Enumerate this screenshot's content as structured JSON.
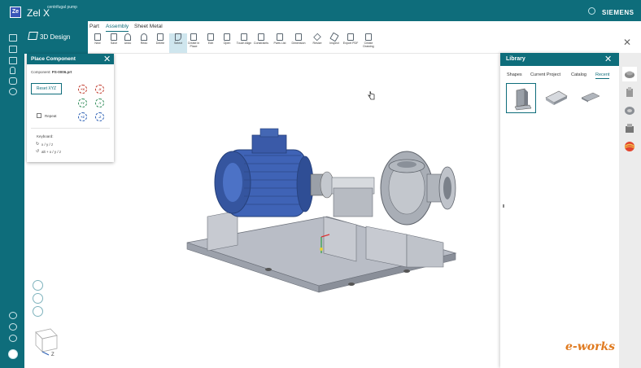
{
  "app": {
    "logo": "Ze",
    "name": "Zel X",
    "file": "centrifugal pump",
    "brand": "SIEMENS"
  },
  "mode": {
    "label": "3D Design"
  },
  "ribbon": {
    "tabs": [
      {
        "label": "Part",
        "active": false
      },
      {
        "label": "Assembly",
        "active": true
      },
      {
        "label": "Sheet Metal",
        "active": false
      }
    ],
    "tools": [
      {
        "label": "New",
        "icon": "new-icon"
      },
      {
        "label": "Save",
        "icon": "save-icon"
      },
      {
        "label": "Undo",
        "icon": "undo-icon"
      },
      {
        "label": "Redo",
        "icon": "redo-icon"
      },
      {
        "label": "Delete",
        "icon": "delete-icon"
      },
      {
        "label": "Select",
        "icon": "select-icon",
        "selected": true
      },
      {
        "label": "Create in Place",
        "icon": "create-in-place-icon"
      },
      {
        "label": "Edit",
        "icon": "edit-icon"
      },
      {
        "label": "Open",
        "icon": "open-icon"
      },
      {
        "label": "Touch Align",
        "icon": "touch-align-icon"
      },
      {
        "label": "Constraints",
        "icon": "constraints-icon"
      },
      {
        "label": "Parts List",
        "icon": "parts-list-icon"
      },
      {
        "label": "Dimension",
        "icon": "dimension-icon"
      },
      {
        "label": "Resize",
        "icon": "resize-icon"
      },
      {
        "label": "Inspect",
        "icon": "inspect-icon"
      },
      {
        "label": "Export PDF",
        "icon": "export-pdf-icon"
      },
      {
        "label": "Create Drawing",
        "icon": "create-drawing-icon"
      }
    ]
  },
  "place_component": {
    "title": "Place Component",
    "component_label": "Component:",
    "component_file": "PS-0006.prt",
    "reset_label": "Reset XYZ",
    "rotations": [
      "+X",
      "-X",
      "+Y",
      "-Y",
      "+Z",
      "-Z"
    ],
    "repeat_label": "Repeat",
    "keyboard_title": "Keyboard:",
    "keyboard_lines": [
      "x / y / z",
      "alt + x / y / z"
    ]
  },
  "library": {
    "title": "Library",
    "tabs": [
      {
        "label": "Shapes",
        "active": false
      },
      {
        "label": "Current Project",
        "active": false
      },
      {
        "label": "Catalog",
        "active": false
      },
      {
        "label": "Recent",
        "active": true
      }
    ]
  },
  "triad": {
    "z": "Z"
  },
  "watermark": "e-works",
  "colors": {
    "accent": "#0e6d7b",
    "selected_tool": "#cfe6ee",
    "library_bg": "#ececec"
  }
}
